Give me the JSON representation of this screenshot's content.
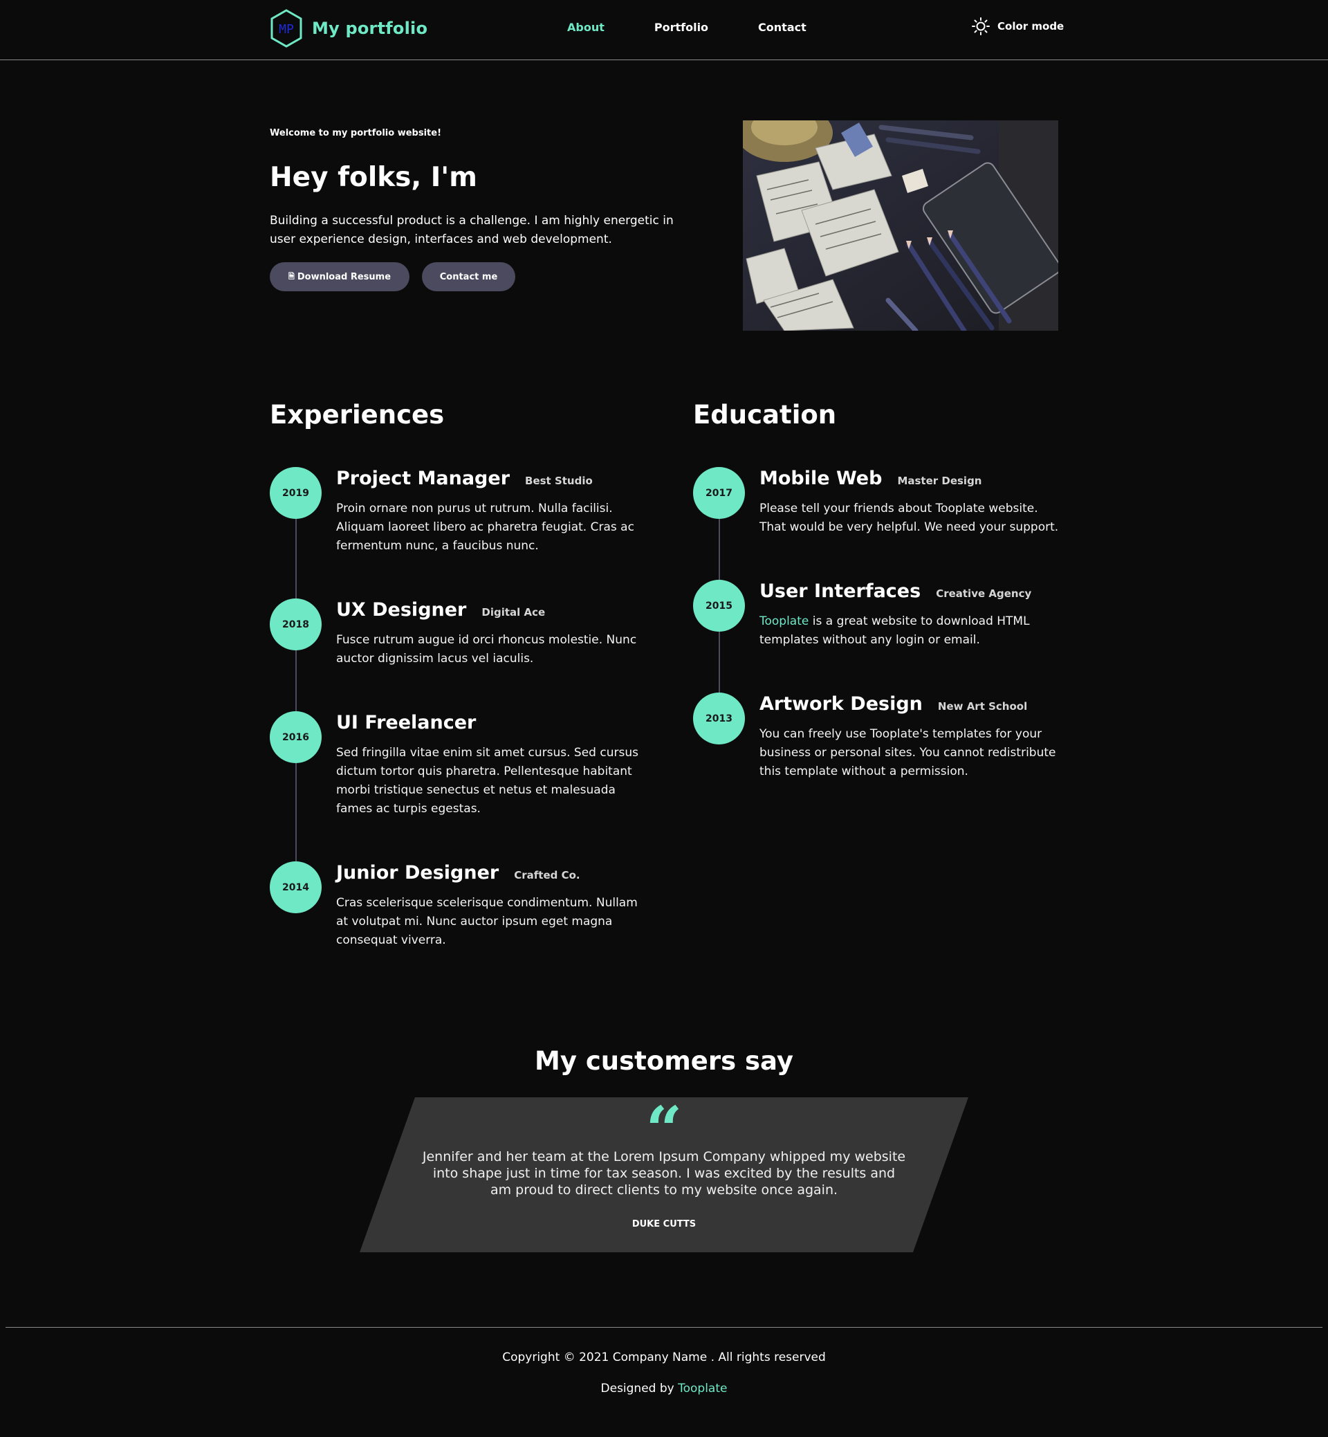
{
  "nav": {
    "logo_text": "MP",
    "brand": "My portfolio",
    "links": [
      "About",
      "Portfolio",
      "Contact"
    ],
    "color_mode": "Color mode"
  },
  "hero": {
    "welcome": "Welcome to my portfolio website!",
    "title": "Hey folks, I'm",
    "text": "Building a successful product is a challenge. I am highly energetic in user experience design, interfaces and web development.",
    "download_label": "Download Resume",
    "contact_label": "Contact me"
  },
  "experiences": {
    "title": "Experiences",
    "items": [
      {
        "year": "2019",
        "title": "Project Manager",
        "org": "Best Studio",
        "text": "Proin ornare non purus ut rutrum. Nulla facilisi. Aliquam laoreet libero ac pharetra feugiat. Cras ac fermentum nunc, a faucibus nunc."
      },
      {
        "year": "2018",
        "title": "UX Designer",
        "org": "Digital Ace",
        "text": "Fusce rutrum augue id orci rhoncus molestie. Nunc auctor dignissim lacus vel iaculis."
      },
      {
        "year": "2016",
        "title": "UI Freelancer",
        "org": "",
        "text": "Sed fringilla vitae enim sit amet cursus. Sed cursus dictum tortor quis pharetra. Pellentesque habitant morbi tristique senectus et netus et malesuada fames ac turpis egestas."
      },
      {
        "year": "2014",
        "title": "Junior Designer",
        "org": "Crafted Co.",
        "text": "Cras scelerisque scelerisque condimentum. Nullam at volutpat mi. Nunc auctor ipsum eget magna consequat viverra."
      }
    ]
  },
  "education": {
    "title": "Education",
    "items": [
      {
        "year": "2017",
        "title": "Mobile Web",
        "org": "Master Design",
        "text": "Please tell your friends about Tooplate website. That would be very helpful. We need your support."
      },
      {
        "year": "2015",
        "title": "User Interfaces",
        "org": "Creative Agency",
        "link": "Tooplate",
        "text": " is a great website to download HTML templates without any login or email."
      },
      {
        "year": "2013",
        "title": "Artwork Design",
        "org": "New Art School",
        "text": "You can freely use Tooplate's templates for your business or personal sites. You cannot redistribute this template without a permission."
      }
    ]
  },
  "testimonial": {
    "title": "My customers say",
    "quote_mark": "“",
    "text": "Jennifer and her team at the Lorem Ipsum Company whipped my website into shape just in time for tax season. I was excited by the results and am proud to direct clients to my website once again.",
    "author": "DUKE CUTTS"
  },
  "footer": {
    "copyright": "Copyright © 2021 Company Name . All rights reserved",
    "designed_prefix": "Designed by ",
    "designed_link": "Tooplate"
  },
  "colors": {
    "accent": "#6fe8c6",
    "button": "#4b4a5e",
    "background": "#0b0b0b",
    "card": "#363636",
    "logo_text": "#1f2bd6"
  },
  "icons": [
    "hexagon-logo-icon",
    "sun-icon",
    "document-icon",
    "quote-icon"
  ]
}
